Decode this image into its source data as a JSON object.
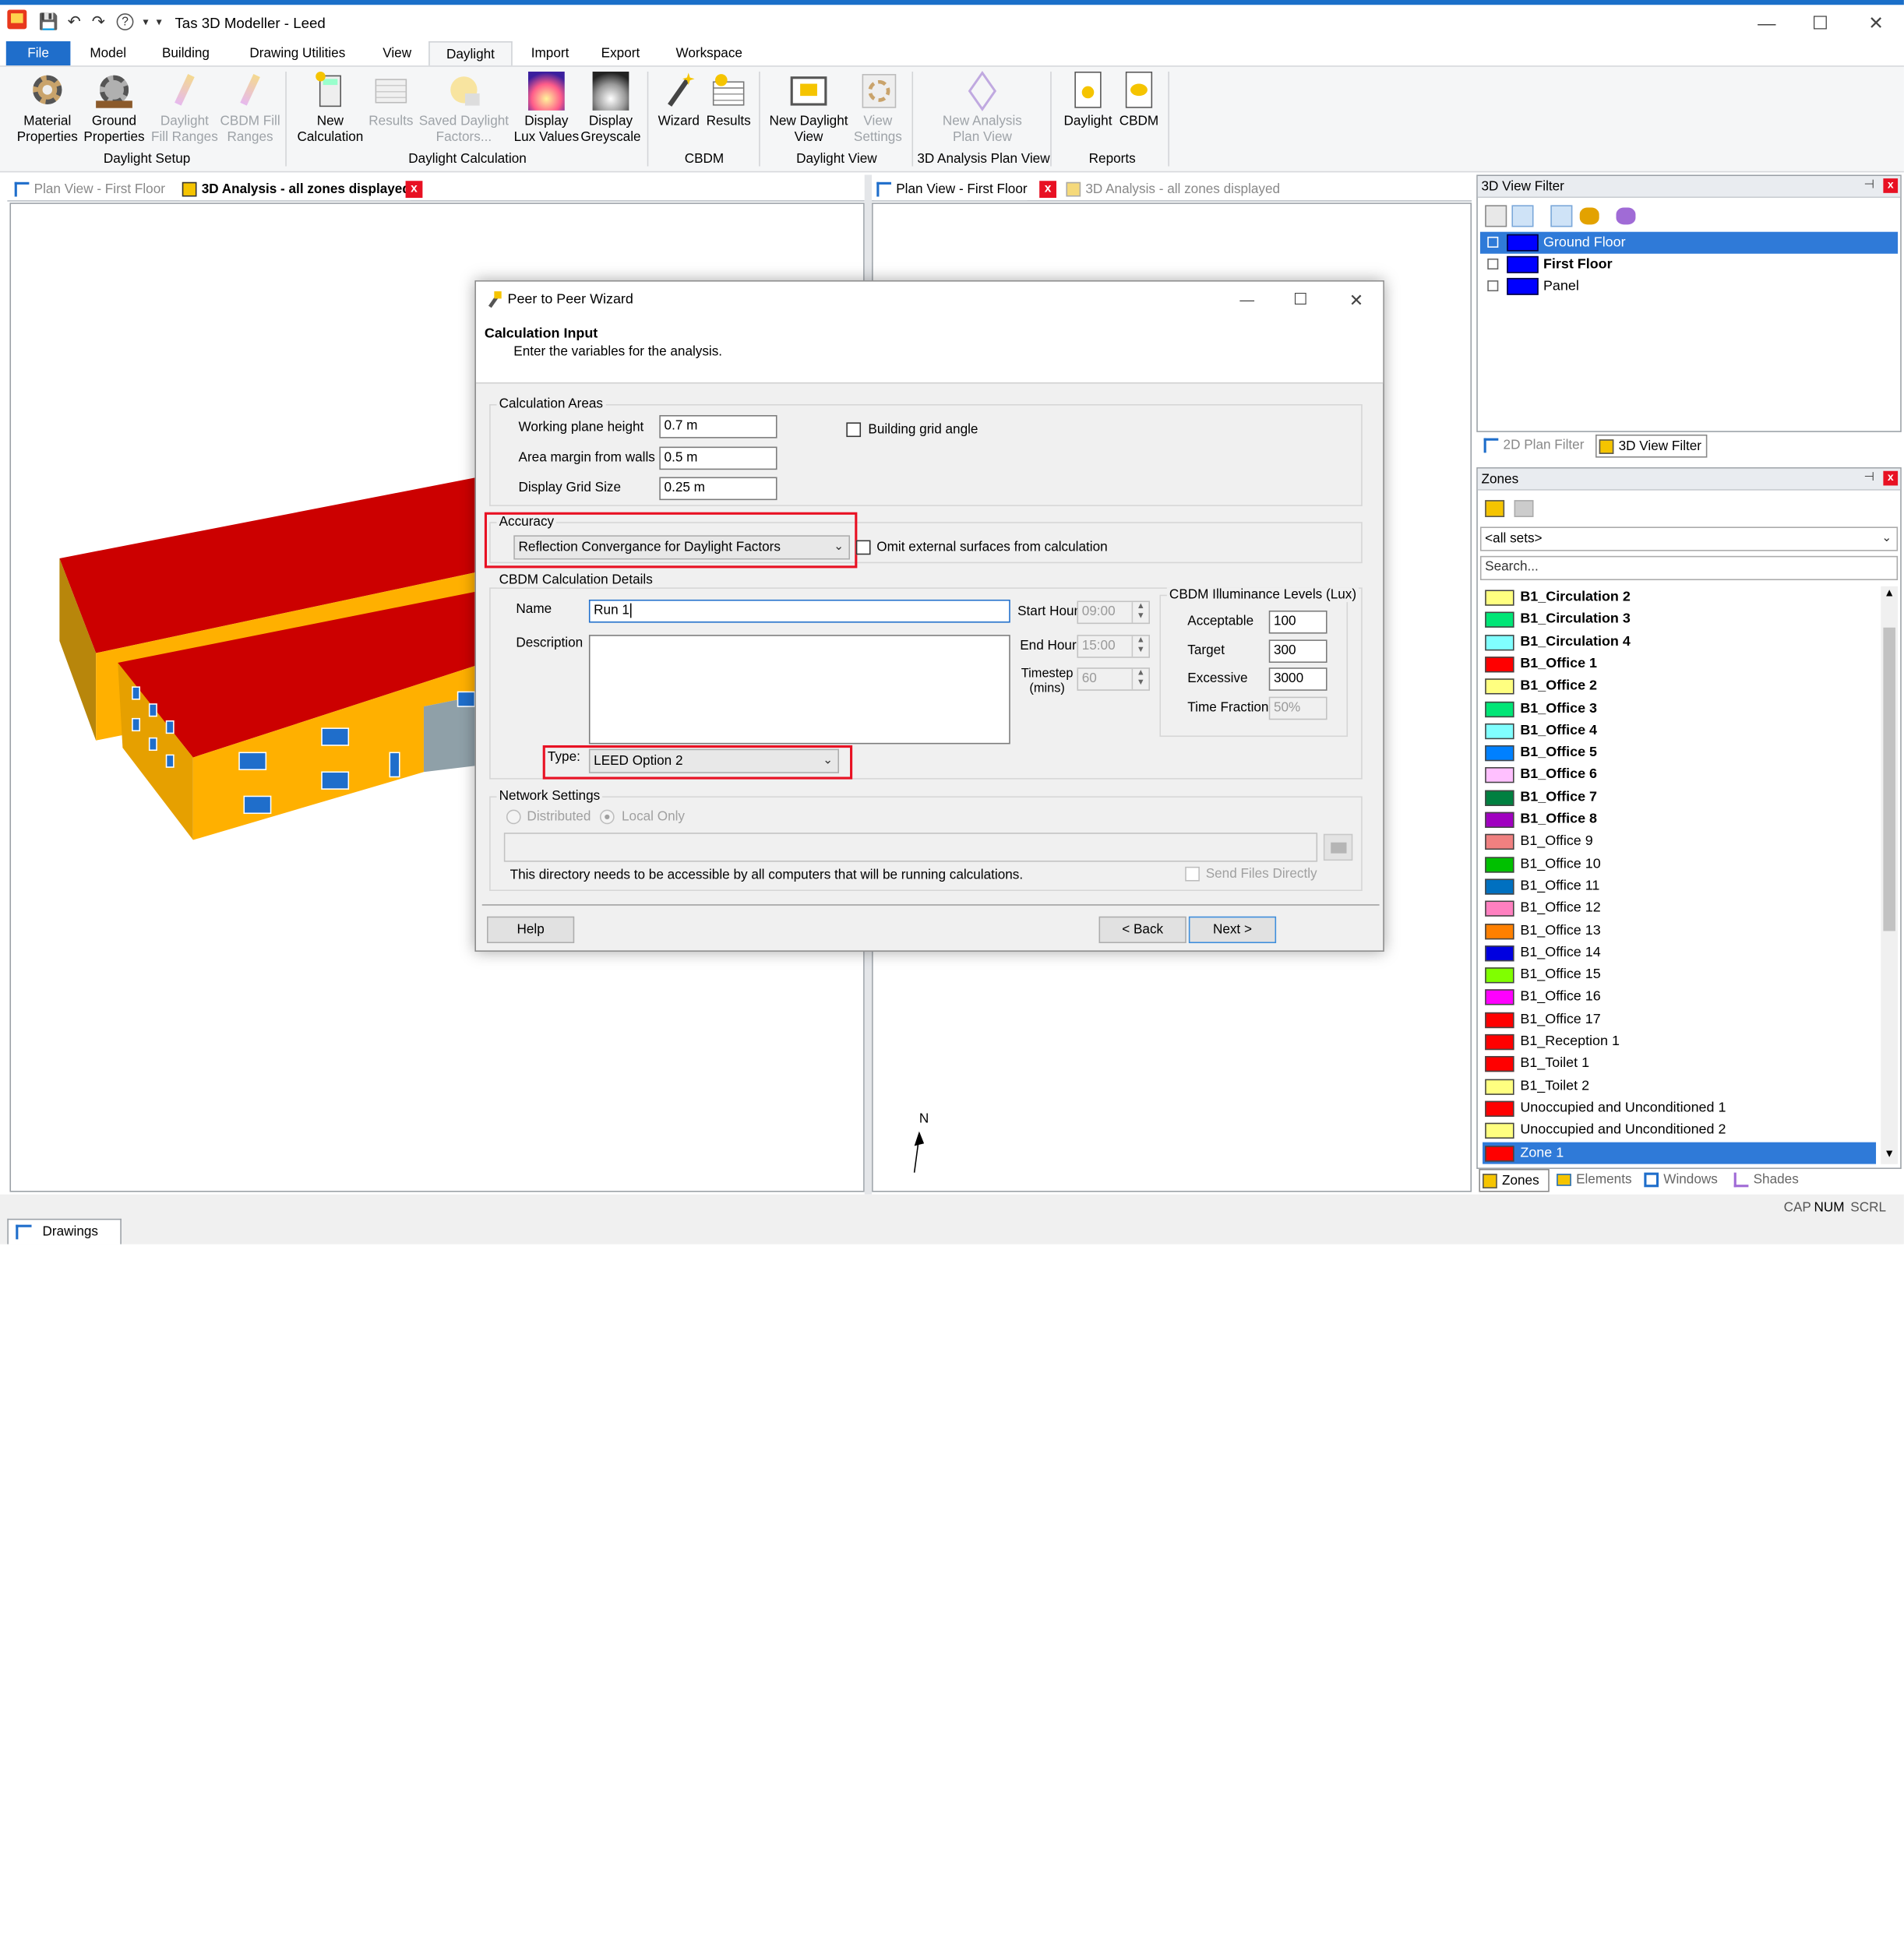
{
  "window": {
    "title": "Tas 3D Modeller - Leed",
    "help_glyph": "?",
    "qat_menu": "▾"
  },
  "menu_tabs": [
    "File",
    "Model",
    "Building",
    "Drawing Utilities",
    "View",
    "Daylight",
    "Import",
    "Export",
    "Workspace"
  ],
  "ribbon": {
    "buttons": [
      {
        "l1": "Material",
        "l2": "Properties",
        "dis": false
      },
      {
        "l1": "Ground",
        "l2": "Properties",
        "dis": false
      },
      {
        "l1": "Daylight",
        "l2": "Fill Ranges",
        "dis": true
      },
      {
        "l1": "CBDM Fill",
        "l2": "Ranges",
        "dis": true
      },
      {
        "l1": "New",
        "l2": "Calculation",
        "dis": false
      },
      {
        "l1": "Results",
        "l2": "",
        "dis": true
      },
      {
        "l1": "Saved Daylight",
        "l2": "Factors...",
        "dis": true
      },
      {
        "l1": "Display",
        "l2": "Lux Values",
        "dis": false
      },
      {
        "l1": "Display",
        "l2": "Greyscale",
        "dis": false
      },
      {
        "l1": "Wizard",
        "l2": "",
        "dis": false
      },
      {
        "l1": "Results",
        "l2": "",
        "dis": false
      },
      {
        "l1": "New Daylight",
        "l2": "View",
        "dis": false
      },
      {
        "l1": "View",
        "l2": "Settings",
        "dis": true
      },
      {
        "l1": "New Analysis",
        "l2": "Plan View",
        "dis": true
      },
      {
        "l1": "Daylight",
        "l2": "",
        "dis": false
      },
      {
        "l1": "CBDM",
        "l2": "",
        "dis": false
      }
    ],
    "groups": [
      "Daylight Setup",
      "Daylight Calculation",
      "CBDM",
      "Daylight View",
      "3D Analysis Plan View",
      "Reports"
    ]
  },
  "left_tabs": {
    "tab1": "Plan View - First Floor",
    "tab2": "3D Analysis - all zones displayed",
    "close": "x"
  },
  "right_tabs": {
    "tab1": "Plan View - First Floor",
    "tab2": "3D Analysis - all zones displayed",
    "close": "x"
  },
  "compass": "N",
  "filter_panel": {
    "title": "3D View Filter",
    "pin": "⊣",
    "close": "x",
    "items": [
      "Ground Floor",
      "First Floor",
      "Panel"
    ],
    "tab_2d": "2D Plan Filter",
    "tab_3d": "3D View Filter"
  },
  "zones_panel": {
    "title": "Zones",
    "pin": "⊣",
    "close": "x",
    "set_value": "<all sets>",
    "search_placeholder": "Search...",
    "zones": [
      {
        "name": "B1_Circulation 2",
        "color": "#ffff80",
        "bold": true
      },
      {
        "name": "B1_Circulation 3",
        "color": "#00e676",
        "bold": true
      },
      {
        "name": "B1_Circulation 4",
        "color": "#80ffff",
        "bold": true
      },
      {
        "name": "B1_Office 1",
        "color": "#ff0000",
        "bold": true
      },
      {
        "name": "B1_Office 2",
        "color": "#ffff80",
        "bold": true
      },
      {
        "name": "B1_Office 3",
        "color": "#00e676",
        "bold": true
      },
      {
        "name": "B1_Office 4",
        "color": "#80ffff",
        "bold": true
      },
      {
        "name": "B1_Office 5",
        "color": "#0080ff",
        "bold": true
      },
      {
        "name": "B1_Office 6",
        "color": "#ffc0ff",
        "bold": true
      },
      {
        "name": "B1_Office 7",
        "color": "#008040",
        "bold": true
      },
      {
        "name": "B1_Office 8",
        "color": "#a000c0",
        "bold": true
      },
      {
        "name": "B1_Office 9",
        "color": "#f08080",
        "bold": false
      },
      {
        "name": "B1_Office 10",
        "color": "#00c000",
        "bold": false
      },
      {
        "name": "B1_Office 11",
        "color": "#0070c0",
        "bold": false
      },
      {
        "name": "B1_Office 12",
        "color": "#ff80c0",
        "bold": false
      },
      {
        "name": "B1_Office 13",
        "color": "#ff8000",
        "bold": false
      },
      {
        "name": "B1_Office 14",
        "color": "#0000e0",
        "bold": false
      },
      {
        "name": "B1_Office 15",
        "color": "#80ff00",
        "bold": false
      },
      {
        "name": "B1_Office 16",
        "color": "#ff00ff",
        "bold": false
      },
      {
        "name": "B1_Office 17",
        "color": "#ff0000",
        "bold": false
      },
      {
        "name": "B1_Reception 1",
        "color": "#ff0000",
        "bold": false
      },
      {
        "name": "B1_Toilet 1",
        "color": "#ff0000",
        "bold": false
      },
      {
        "name": "B1_Toilet 2",
        "color": "#ffff80",
        "bold": false
      },
      {
        "name": "Unoccupied and Unconditioned 1",
        "color": "#ff0000",
        "bold": false
      },
      {
        "name": "Unoccupied and Unconditioned 2",
        "color": "#ffff80",
        "bold": false
      },
      {
        "name": "Zone 1",
        "color": "#ff0000",
        "bold": false
      }
    ],
    "bottom_tabs": [
      "Zones",
      "Elements",
      "Windows",
      "Shades"
    ]
  },
  "dialog": {
    "title": "Peer to Peer Wizard",
    "heading": "Calculation Input",
    "subheading": "Enter the variables for the analysis.",
    "calc_areas": {
      "caption": "Calculation Areas",
      "working_plane_label": "Working plane height",
      "working_plane_value": "0.7 m",
      "area_margin_label": "Area margin from walls",
      "area_margin_value": "0.5 m",
      "grid_size_label": "Display Grid Size",
      "grid_size_value": "0.25 m",
      "grid_angle_label": "Building grid angle"
    },
    "accuracy": {
      "caption": "Accuracy",
      "value": "Reflection Convergance for Daylight Factors",
      "omit_label": "Omit external surfaces from calculation"
    },
    "cbdm": {
      "caption": "CBDM Calculation Details",
      "name_label": "Name",
      "name_value": "Run 1",
      "description_label": "Description",
      "type_label": "Type:",
      "type_value": "LEED Option 2",
      "start_hour_label": "Start Hour",
      "start_hour_value": "09:00",
      "end_hour_label": "End Hour",
      "end_hour_value": "15:00",
      "timestep_label1": "Timestep",
      "timestep_label2": "(mins)",
      "timestep_value": "60"
    },
    "illum": {
      "caption": "CBDM Illuminance Levels (Lux)",
      "acceptable_label": "Acceptable",
      "acceptable_value": "100",
      "target_label": "Target",
      "target_value": "300",
      "excessive_label": "Excessive",
      "excessive_value": "3000",
      "time_fraction_label": "Time Fraction",
      "time_fraction_value": "50%"
    },
    "network": {
      "caption": "Network Settings",
      "distributed_label": "Distributed",
      "local_label": "Local Only",
      "note": "This directory needs to be accessible by all computers that will be running calculations.",
      "send_files_label": "Send Files Directly"
    },
    "buttons": {
      "help": "Help",
      "back": "< Back",
      "next": "Next >"
    }
  },
  "status": {
    "drawings_tab": "Drawings",
    "cap": "CAP",
    "num": "NUM",
    "scrl": "SCRL"
  }
}
